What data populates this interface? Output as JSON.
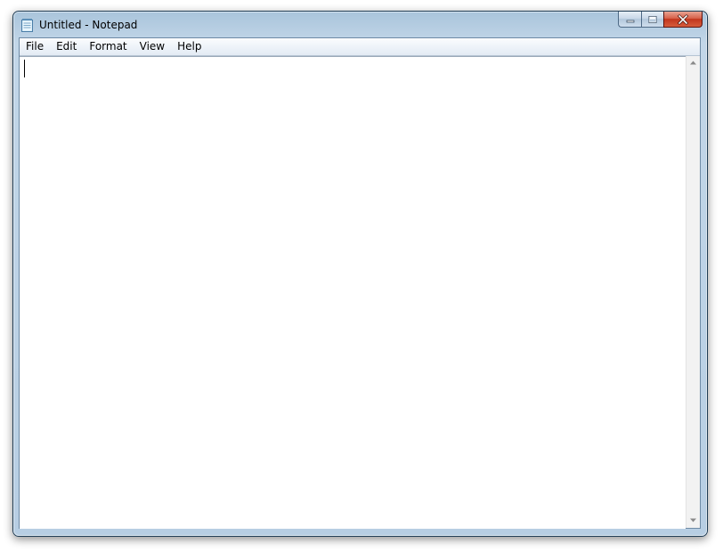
{
  "window": {
    "title": "Untitled - Notepad",
    "app_icon": "notepad-icon"
  },
  "caption_buttons": {
    "minimize_icon": "minimize-icon",
    "maximize_icon": "maximize-icon",
    "close_icon": "close-icon"
  },
  "menubar": {
    "items": [
      {
        "label": "File"
      },
      {
        "label": "Edit"
      },
      {
        "label": "Format"
      },
      {
        "label": "View"
      },
      {
        "label": "Help"
      }
    ]
  },
  "editor": {
    "content": ""
  },
  "scrollbar": {
    "up_icon": "scroll-up-arrow-icon",
    "down_icon": "scroll-down-arrow-icon"
  },
  "colors": {
    "frame": "#b7cee3",
    "close_button": "#c2351d",
    "menubar": "#eef3f9"
  }
}
